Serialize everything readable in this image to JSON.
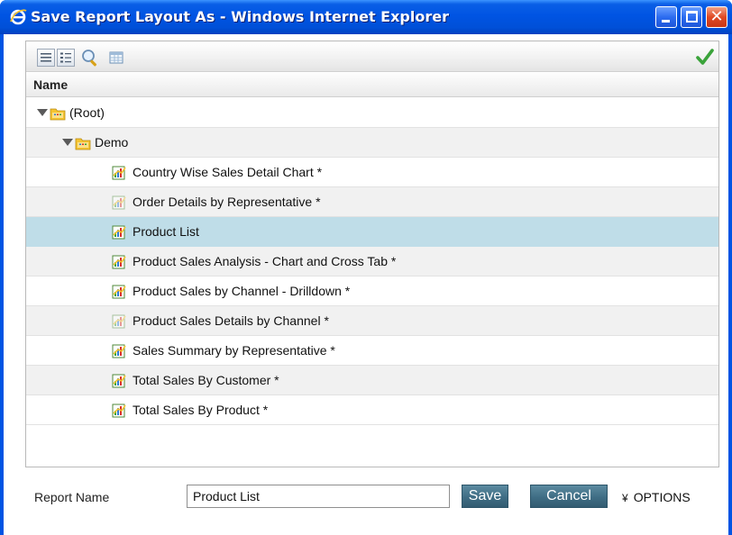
{
  "window": {
    "title": "Save Report Layout As - Windows Internet Explorer",
    "close_glyph": "✕"
  },
  "toolbar": {
    "icons": [
      "list-view-icon",
      "details-view-icon",
      "search-icon",
      "grid-icon",
      "checkmark-icon"
    ]
  },
  "list": {
    "header": "Name",
    "rows": [
      {
        "label": "(Root)",
        "type": "folder",
        "expanded": true
      },
      {
        "label": "Demo",
        "type": "folder",
        "expanded": true
      },
      {
        "label": "Country Wise Sales Detail Chart *",
        "type": "report"
      },
      {
        "label": "Order Details by Representative *",
        "type": "report-faded"
      },
      {
        "label": "Product List",
        "type": "report",
        "selected": true
      },
      {
        "label": "Product Sales Analysis - Chart and Cross Tab *",
        "type": "report"
      },
      {
        "label": "Product Sales by Channel - Drilldown *",
        "type": "report"
      },
      {
        "label": "Product Sales Details by Channel *",
        "type": "report-faded"
      },
      {
        "label": "Sales Summary by Representative *",
        "type": "report"
      },
      {
        "label": "Total Sales By Customer *",
        "type": "report"
      },
      {
        "label": "Total Sales By Product *",
        "type": "report"
      }
    ]
  },
  "form": {
    "report_name_label": "Report Name",
    "report_name_value": "Product List",
    "save_label": "Save",
    "cancel_label": "Cancel",
    "options_label": "OPTIONS",
    "options_glyph": "¥"
  },
  "colors": {
    "titlebar": "#0054e3",
    "selected_row": "#bfdde8",
    "button": "#3f6d84",
    "check": "#3aa33a"
  }
}
